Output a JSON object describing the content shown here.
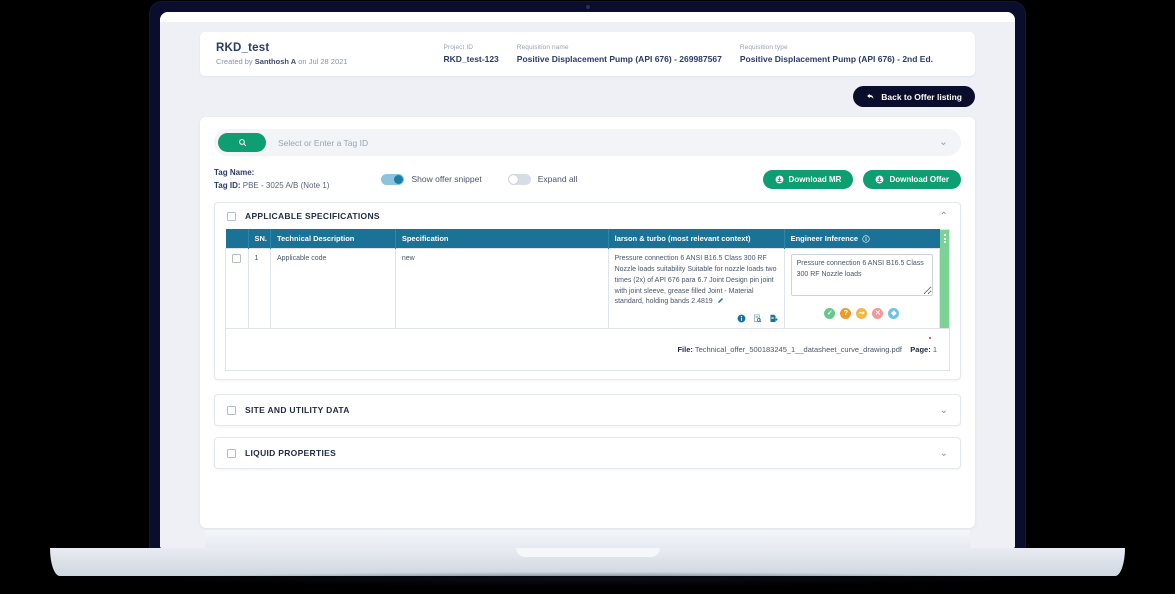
{
  "header": {
    "project_title": "RKD_test",
    "created_prefix": "Created by",
    "created_by": "Santhosh A",
    "created_mid": "on",
    "created_date": "Jul 28 2021",
    "project_id_label": "Project ID",
    "project_id_value": "RKD_test-123",
    "requisition_name_label": "Requisition name",
    "requisition_name_value": "Positive Displacement Pump (API 676) - 269987567",
    "requisition_type_label": "Requisition type",
    "requisition_type_value": "Positive Displacement Pump (API 676) - 2nd Ed."
  },
  "actions": {
    "back_label": "Back to Offer listing",
    "back_icon": "arrow-back-icon"
  },
  "search": {
    "placeholder": "Select or Enter a Tag ID",
    "value": "",
    "icon": "search-icon",
    "chevron": "chevron-down-icon"
  },
  "tag": {
    "name_label": "Tag Name:",
    "name_value": "",
    "id_label": "Tag ID:",
    "id_value": "PBE - 3025 A/B (Note 1)"
  },
  "toggles": [
    {
      "label": "Show offer snippet",
      "state": "on"
    },
    {
      "label": "Expand all",
      "state": "off"
    }
  ],
  "downloads": [
    {
      "label": "Download MR",
      "icon": "download-circle-icon"
    },
    {
      "label": "Download Offer",
      "icon": "download-circle-icon"
    }
  ],
  "sections": [
    {
      "title": "APPLICABLE SPECIFICATIONS",
      "expanded": true,
      "chevron": "chevron-up-icon"
    },
    {
      "title": "SITE AND UTILITY DATA",
      "expanded": false,
      "chevron": "chevron-down-icon"
    },
    {
      "title": "LIQUID PROPERTIES",
      "expanded": false,
      "chevron": "chevron-down-icon"
    }
  ],
  "table": {
    "columns": [
      "",
      "SN.",
      "Technical Description",
      "Specification",
      "larson & turbo (most relevant context)",
      "Engineer Inference"
    ],
    "inference_info_icon": "info-circle-icon",
    "rows": [
      {
        "sn": "1",
        "technical_description": "Applicable code",
        "specification": "new",
        "context": "Pressure connection 6 ANSI B16.5 Class 300 RF Nozzle loads suitability Suitable for nozzle loads two times (2x) of API 676 para 6.7 Joint Design pin joint with joint sleeve, grease filled Joint - Material standard, holding bands 2.4819",
        "context_edit_icon": "pencil-icon",
        "context_icons": [
          "info-circle-icon",
          "document-search-icon",
          "document-export-icon"
        ],
        "inference_value": "Pressure connection 6 ANSI B16.5 Class 300 RF Nozzle loads",
        "inference_actions": [
          "accept-check-icon",
          "question-icon",
          "forward-icon",
          "reject-close-icon",
          "tag-icon"
        ]
      }
    ]
  },
  "file_info": {
    "file_label": "File:",
    "file_name": "Technical_offer_500183245_1__datasheet_curve_drawing.pdf",
    "page_label": "Page:",
    "page_value": "1"
  },
  "colors": {
    "accent_green": "#0f9d72",
    "table_header": "#1a7296",
    "dark_navy": "#0b0d2c",
    "toggle_on": "#1b7fa8",
    "green_bar": "#7cd195"
  }
}
